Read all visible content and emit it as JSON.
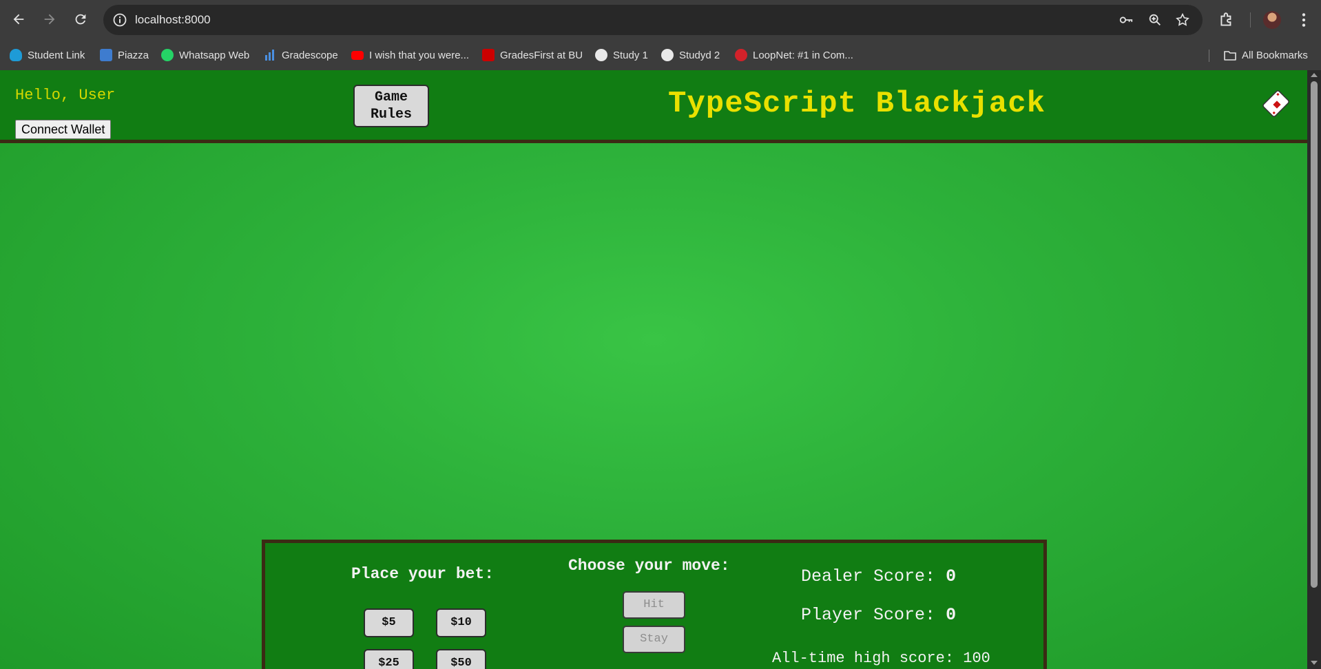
{
  "browser": {
    "url": "localhost:8000",
    "icons": {
      "back": "back-arrow-icon",
      "forward": "forward-arrow-icon",
      "reload": "reload-icon",
      "site_info": "site-info-icon",
      "password": "key-icon",
      "zoom": "zoom-icon",
      "bookmark": "star-icon",
      "extensions": "puzzle-icon",
      "menu": "kebab-menu-icon"
    }
  },
  "bookmarks": {
    "items": [
      {
        "label": "Student Link",
        "icon": "cloud-icon",
        "color": "#1e9bd7"
      },
      {
        "label": "Piazza",
        "icon": "piazza-icon",
        "color": "#3e7ccf"
      },
      {
        "label": "Whatsapp Web",
        "icon": "whatsapp-icon",
        "color": "#25d366"
      },
      {
        "label": "Gradescope",
        "icon": "bar-chart-icon",
        "color": "#4a8fe0"
      },
      {
        "label": "I wish that you were...",
        "icon": "youtube-icon",
        "color": "#ff0000"
      },
      {
        "label": "GradesFirst at BU",
        "icon": "bu-icon",
        "color": "#cc0000"
      },
      {
        "label": "Study 1",
        "icon": "github-icon",
        "color": "#e8e8e8"
      },
      {
        "label": "Studyd 2",
        "icon": "github-icon",
        "color": "#e8e8e8"
      },
      {
        "label": "LoopNet: #1 in Com...",
        "icon": "loopnet-icon",
        "color": "#d3222a"
      }
    ],
    "all_label": "All Bookmarks"
  },
  "header": {
    "greeting": "Hello, User",
    "wallet_button": "Connect Wallet",
    "rules_button_line1": "Game",
    "rules_button_line2": "Rules",
    "title": "TypeScript Blackjack",
    "logo_icon": "cards-icon"
  },
  "controls": {
    "bet": {
      "title": "Place your bet:",
      "buttons": [
        "$5",
        "$10",
        "$25",
        "$50"
      ]
    },
    "move": {
      "title": "Choose your move:",
      "hit": "Hit",
      "stay": "Stay"
    },
    "scores": {
      "dealer_label": "Dealer Score:",
      "dealer_value": "0",
      "player_label": "Player Score:",
      "player_value": "0",
      "high_score": "All-time high score: 100"
    }
  },
  "colors": {
    "felt": "#2db13a",
    "header": "#117d13",
    "title": "#e9e000",
    "border": "#3b2a14"
  }
}
